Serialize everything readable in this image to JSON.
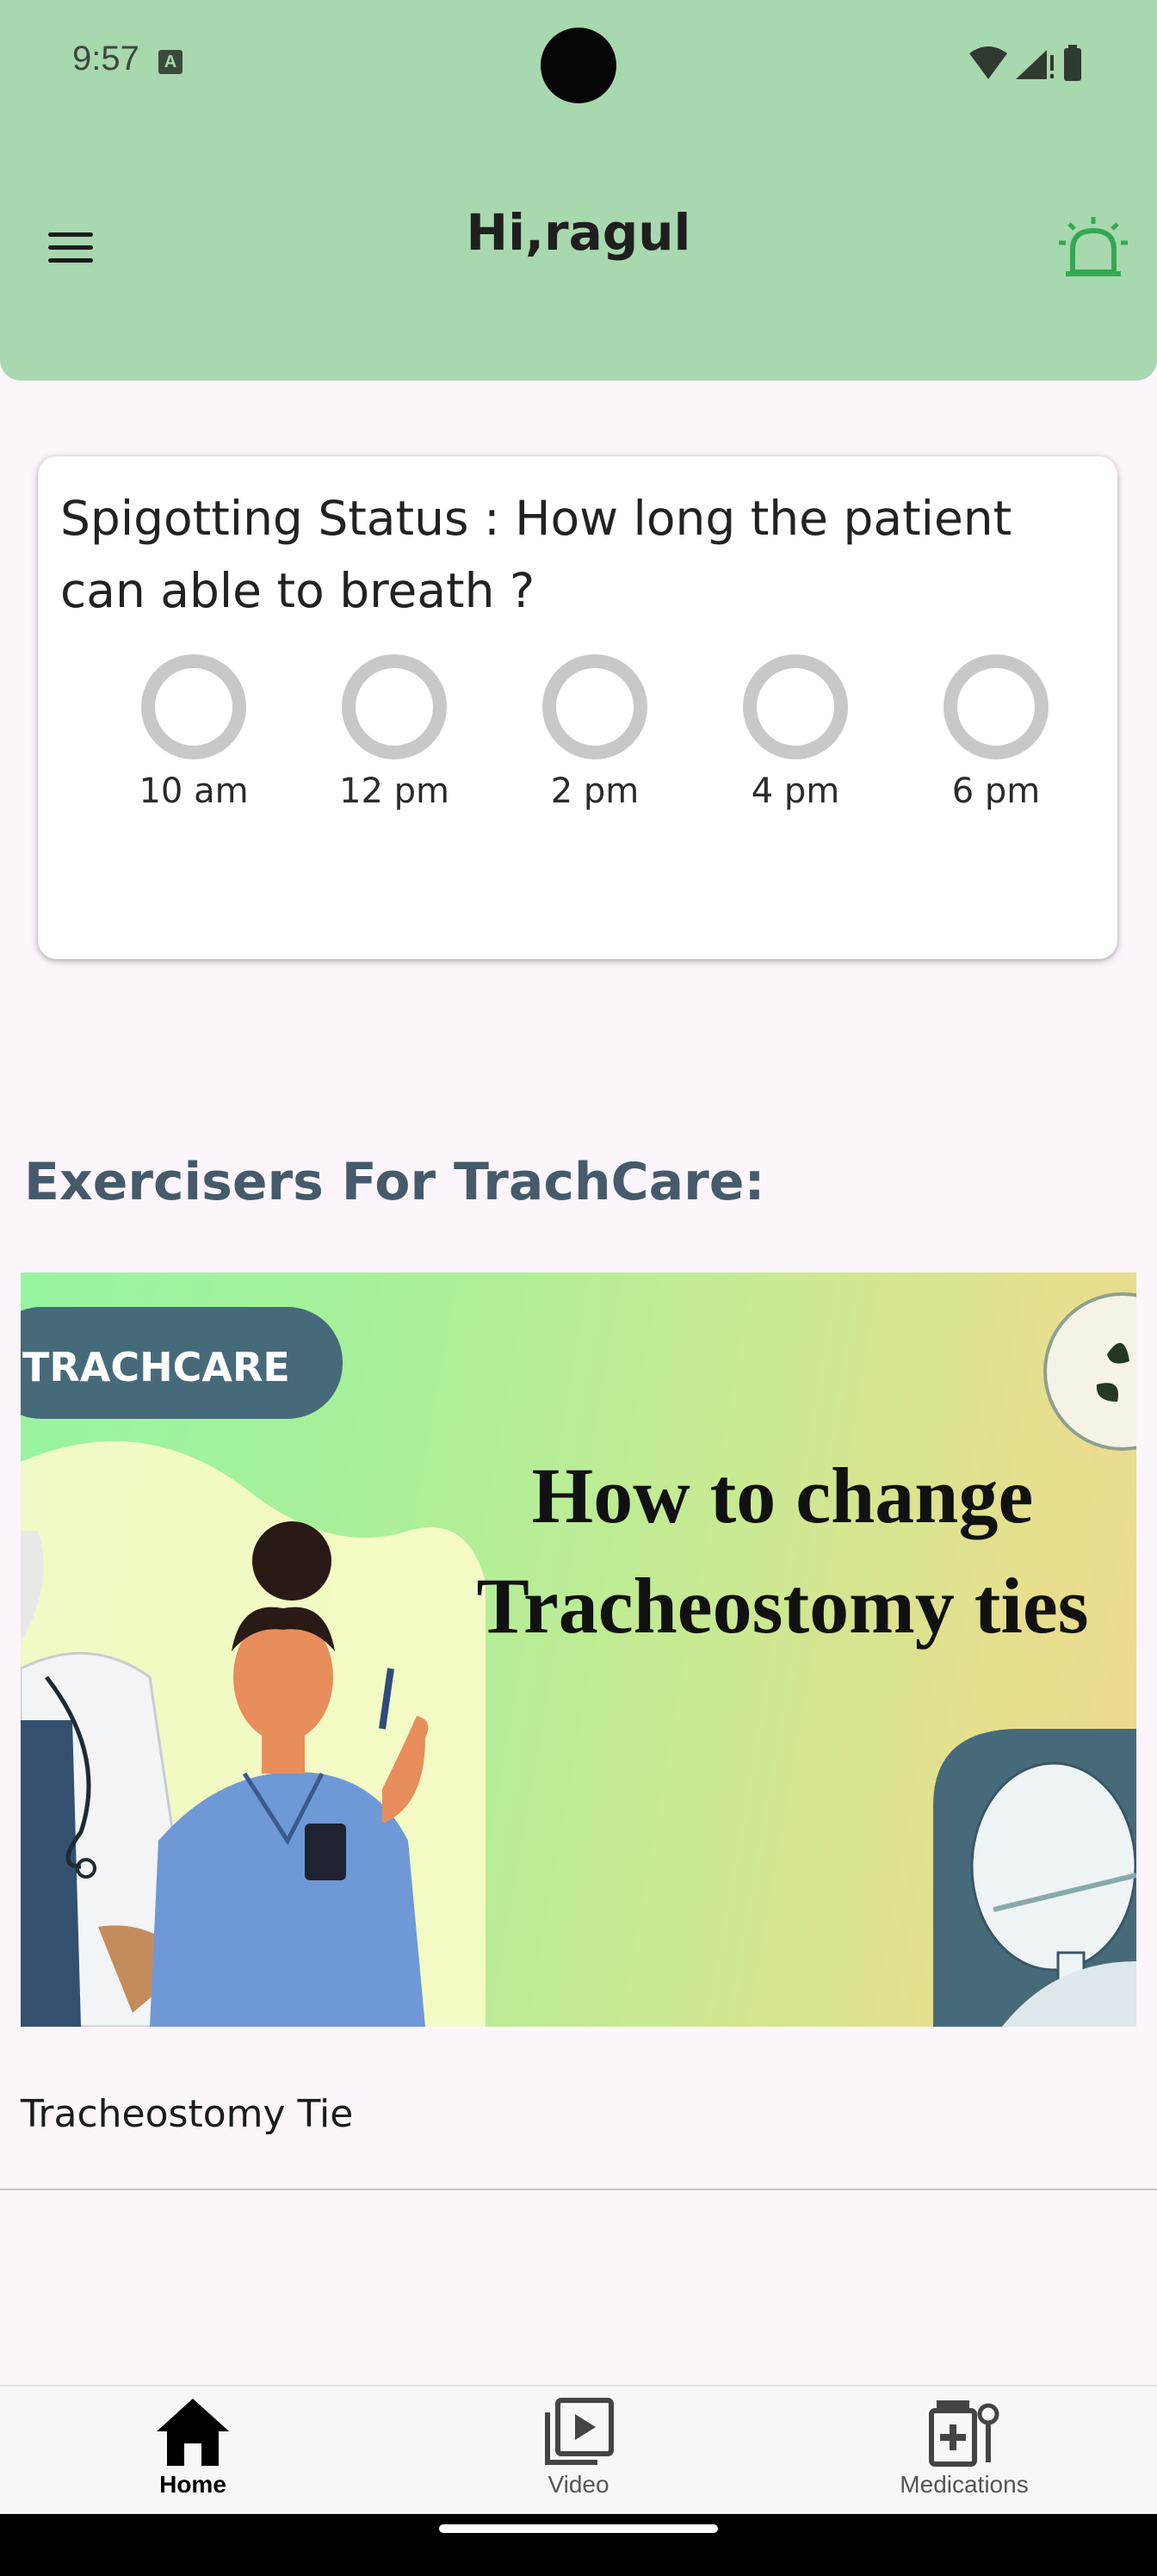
{
  "status_bar": {
    "time": "9:57",
    "badge": "A"
  },
  "header": {
    "greeting": "Hi,ragul",
    "menu_icon": "hamburger-menu-icon",
    "alarm_icon": "alarm-bell-icon",
    "accent": "#34a853"
  },
  "spigotting": {
    "title": "Spigotting Status : How long the patient can able to breath ?",
    "slots": [
      "10 am",
      "12 pm",
      "2 pm",
      "4 pm",
      "6 pm"
    ]
  },
  "exercises": {
    "title": "Exercisers For TrachCare:",
    "video": {
      "badge": "TRACHCARE",
      "headline_line1": "How to change",
      "headline_line2": "Tracheostomy ties",
      "caption": "Tracheostomy Tie"
    }
  },
  "bottom_nav": {
    "items": [
      {
        "label": "Home",
        "icon": "home-icon",
        "active": true
      },
      {
        "label": "Video",
        "icon": "video-library-icon",
        "active": false
      },
      {
        "label": "Medications",
        "icon": "medications-icon",
        "active": false
      }
    ]
  }
}
